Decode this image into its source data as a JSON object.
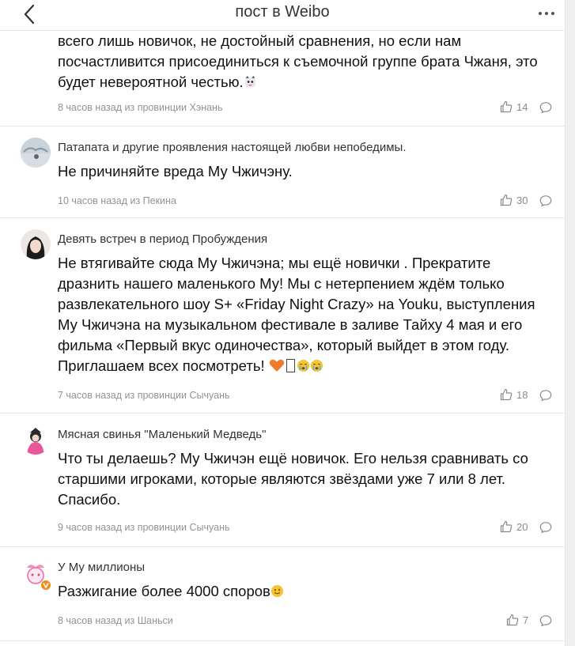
{
  "header": {
    "title": "пост в Weibo",
    "back_icon": "chevron-left-icon",
    "more_icon": "more-horizontal-icon"
  },
  "comments": [
    {
      "text": "всего лишь новичок, не достойный сравнения, но если нам посчастливится присоединиться к съемочной группе брата Чжаня, это будет невероятной честью.",
      "meta": "8 часов назад из провинции Хэнань",
      "likes": "14"
    },
    {
      "author": "Патапата и другие проявления настоящей любви непобедимы.",
      "text": "Не причиняйте вреда Му Чжичэну.",
      "meta": "10 часов назад из Пекина",
      "likes": "30"
    },
    {
      "author": "Девять встреч в период Пробуждения",
      "text": "Не втягивайте сюда Му Чжичэна; мы ещё новички . Прекратите дразнить нашего маленького Му! Мы с нетерпением ждём только развлекательного шоу S+ «Friday Night Crazy» на Youku, выступления Му Чжичэна на музыкальном фестивале в заливе Тайху 4 мая и его фильма «Первый вкус одиночества», который выйдет в этом году. Приглашаем всех посмотреть!",
      "meta": "7 часов назад из провинции Сычуань",
      "likes": "18"
    },
    {
      "author": "Мясная свинья \"Маленький Медведь\"",
      "text": "Что ты делаешь? Му Чжичэн ещё новичок. Его нельзя сравнивать со старшими игроками, которые являются звёздами уже 7 или 8 лет. Спасибо.",
      "meta": "9 часов назад из провинции Сычуань",
      "likes": "20"
    },
    {
      "author": "У Му миллионы",
      "text": "Разжигание более 4000 споров",
      "meta": "8 часов назад из Шаньси",
      "likes": "7"
    }
  ],
  "colors": {
    "meta_gray": "#939393",
    "divider": "#e8e8e8",
    "verified_badge": "#f08c19",
    "heart_orange": "#f07a2a",
    "emoji_yellow": "#f7c531"
  },
  "icons": [
    "thumbs-up-icon",
    "comment-icon",
    "heart-emoji-icon",
    "crying-emoji-icon",
    "smile-emoji-icon",
    "cat-emoji-icon",
    "verified-badge-icon"
  ]
}
